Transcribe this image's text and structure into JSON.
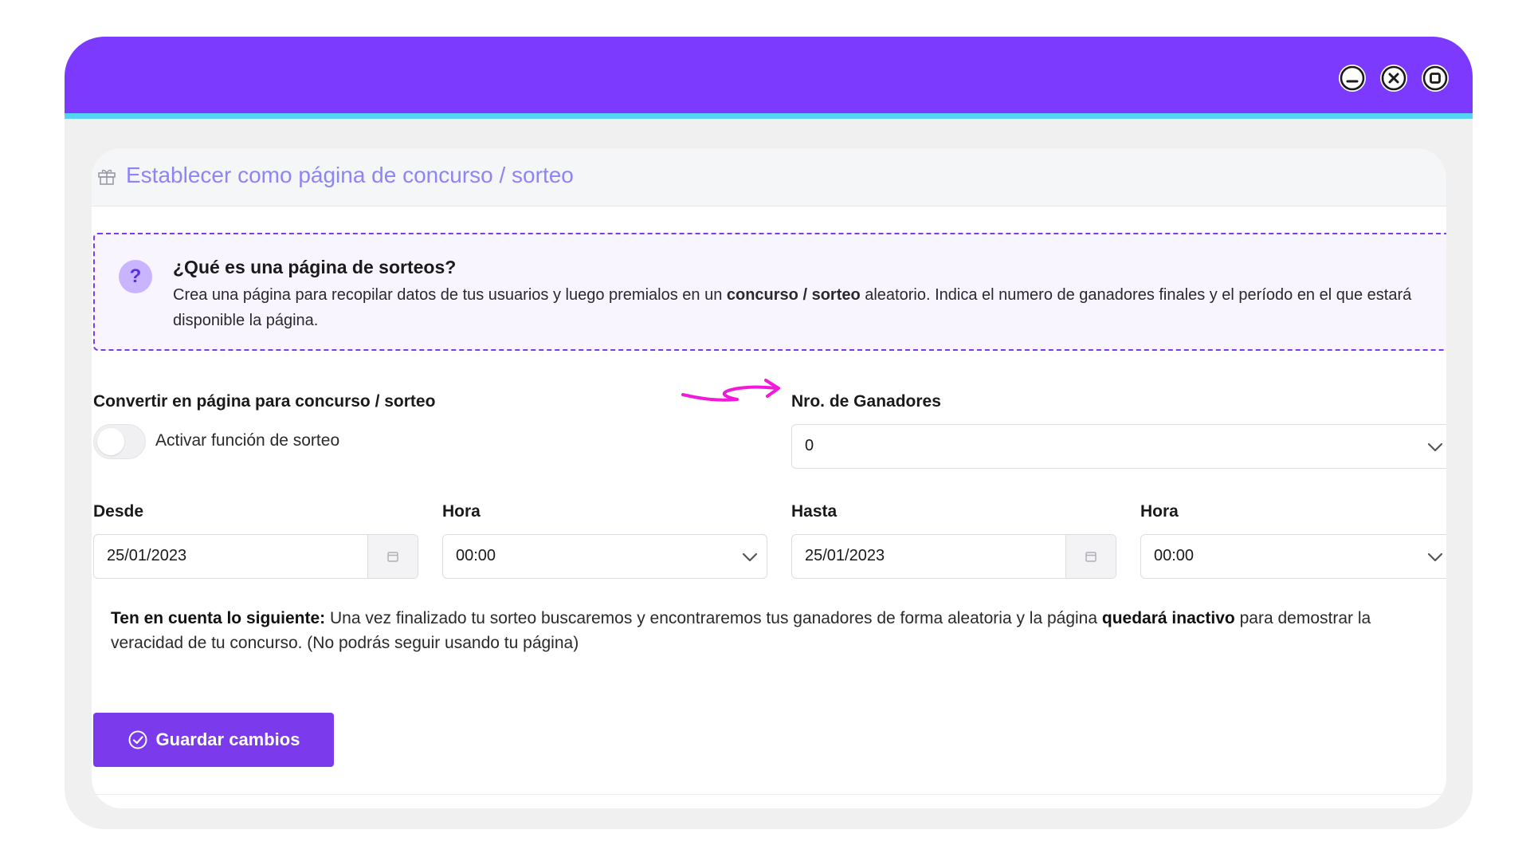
{
  "header": {
    "title": "Establecer como página de concurso / sorteo",
    "icon": "gift-icon"
  },
  "info": {
    "badge": "?",
    "title": "¿Qué es una página de sorteos?",
    "text_before": "Crea una página para recopilar datos de tus usuarios y luego premialos en un ",
    "text_bold": "concurso / sorteo",
    "text_after": " aleatorio. Indica el numero de ganadores finales y el período en el que estará disponible la página."
  },
  "raffle_toggle": {
    "section_label": "Convertir en página para concurso / sorteo",
    "label": "Activar función de sorteo",
    "enabled": false
  },
  "winners": {
    "label": "Nro. de Ganadores",
    "value": "0"
  },
  "from": {
    "date_label": "Desde",
    "date_value": "25/01/2023",
    "time_label": "Hora",
    "time_value": "00:00"
  },
  "to": {
    "date_label": "Hasta",
    "date_value": "25/01/2023",
    "time_label": "Hora",
    "time_value": "00:00"
  },
  "note": {
    "lead_bold": "Ten en cuenta lo siguiente:",
    "text_1": " Una vez finalizado tu sorteo buscaremos y encontraremos tus ganadores de forma aleatoria y la página ",
    "mid_bold": "quedará inactivo",
    "text_2": " para demostrar la veracidad de tu concurso. (No podrás seguir usando tu página)"
  },
  "save_button": {
    "label": "Guardar cambios"
  },
  "colors": {
    "brand": "#7c3aff",
    "accent_line": "#55d3f5",
    "title_text": "#8f84f5",
    "annotation_arrow": "#f21ad8"
  }
}
